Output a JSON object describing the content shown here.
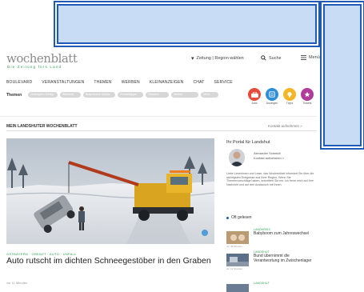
{
  "brand": {
    "logo": "wochenblatt",
    "slogan": "Die Zeitung fürs Land",
    "green": "#2a9d4f"
  },
  "header": {
    "zeitung_label": "Zeitung | Region wählen",
    "suche_label": "Suche",
    "menu_label": "Menü"
  },
  "nav": {
    "items": [
      "BOULEVARD",
      "VERANSTALTUNGEN",
      "THEMEN",
      "WERBEN",
      "KLEINANZEIGEN",
      "CHAT",
      "SERVICE"
    ]
  },
  "themen": {
    "label": "Themen",
    "pills": [
      "Ostbayern-Derby",
      "Blitzlicht",
      "Bayerische Küche",
      "Freizeittipps",
      "Glossen",
      "Wetter",
      "Mehr"
    ]
  },
  "services": [
    {
      "label": "Jobs",
      "color": "#e54a3a",
      "icon": "jobs-icon"
    },
    {
      "label": "Anzeigen",
      "color": "#2e8fd6",
      "icon": "ads-icon"
    },
    {
      "label": "Tipps",
      "color": "#f4b526",
      "icon": "tips-icon"
    },
    {
      "label": "Tickets",
      "color": "#b13b9a",
      "icon": "tickets-icon"
    }
  ],
  "section": {
    "title": "MEIN LANDSHUTER WOCHENBLATT",
    "link": "Kontakt aufnehmen »"
  },
  "hero": {
    "kicker": "OSTBAYERN · GRENZT · AUTO · UNFALL",
    "title": "Auto rutscht im dichten Schneegestöber in den Graben",
    "date": "vor 11 Minuten"
  },
  "sidebar": {
    "title": "Ihr Portal für Landshut",
    "author": "Alexander Schmidt",
    "contact": "Kontakt aufnehmen »",
    "text": "Liebe Leserinnen und Leser, das Wochenblatt informiert Sie über die wichtigsten Ereignisse aus Ihrer Region. Wenn Sie Themenvorschläge haben, schreiben Sie mir. Ich freue mich auf Ihre Nachricht und auf den Austausch mit Ihnen."
  },
  "oft_gelesen": {
    "heading": "Oft gelesen",
    "items": [
      {
        "kicker": "LANDKREIS",
        "title": "Babyboom zum Jahreswechsel",
        "date": "vor 45 Minuten",
        "color": "#a58a66"
      },
      {
        "kicker": "LANDSHUT",
        "title": "Bund übernimmt die Verantwortung im Zwischenlager",
        "date": "vor 12 Stunden",
        "color": "#5b6f88"
      },
      {
        "kicker": "LANDSHUT",
        "title": "",
        "date": "",
        "color": "#6a7c94"
      }
    ]
  }
}
